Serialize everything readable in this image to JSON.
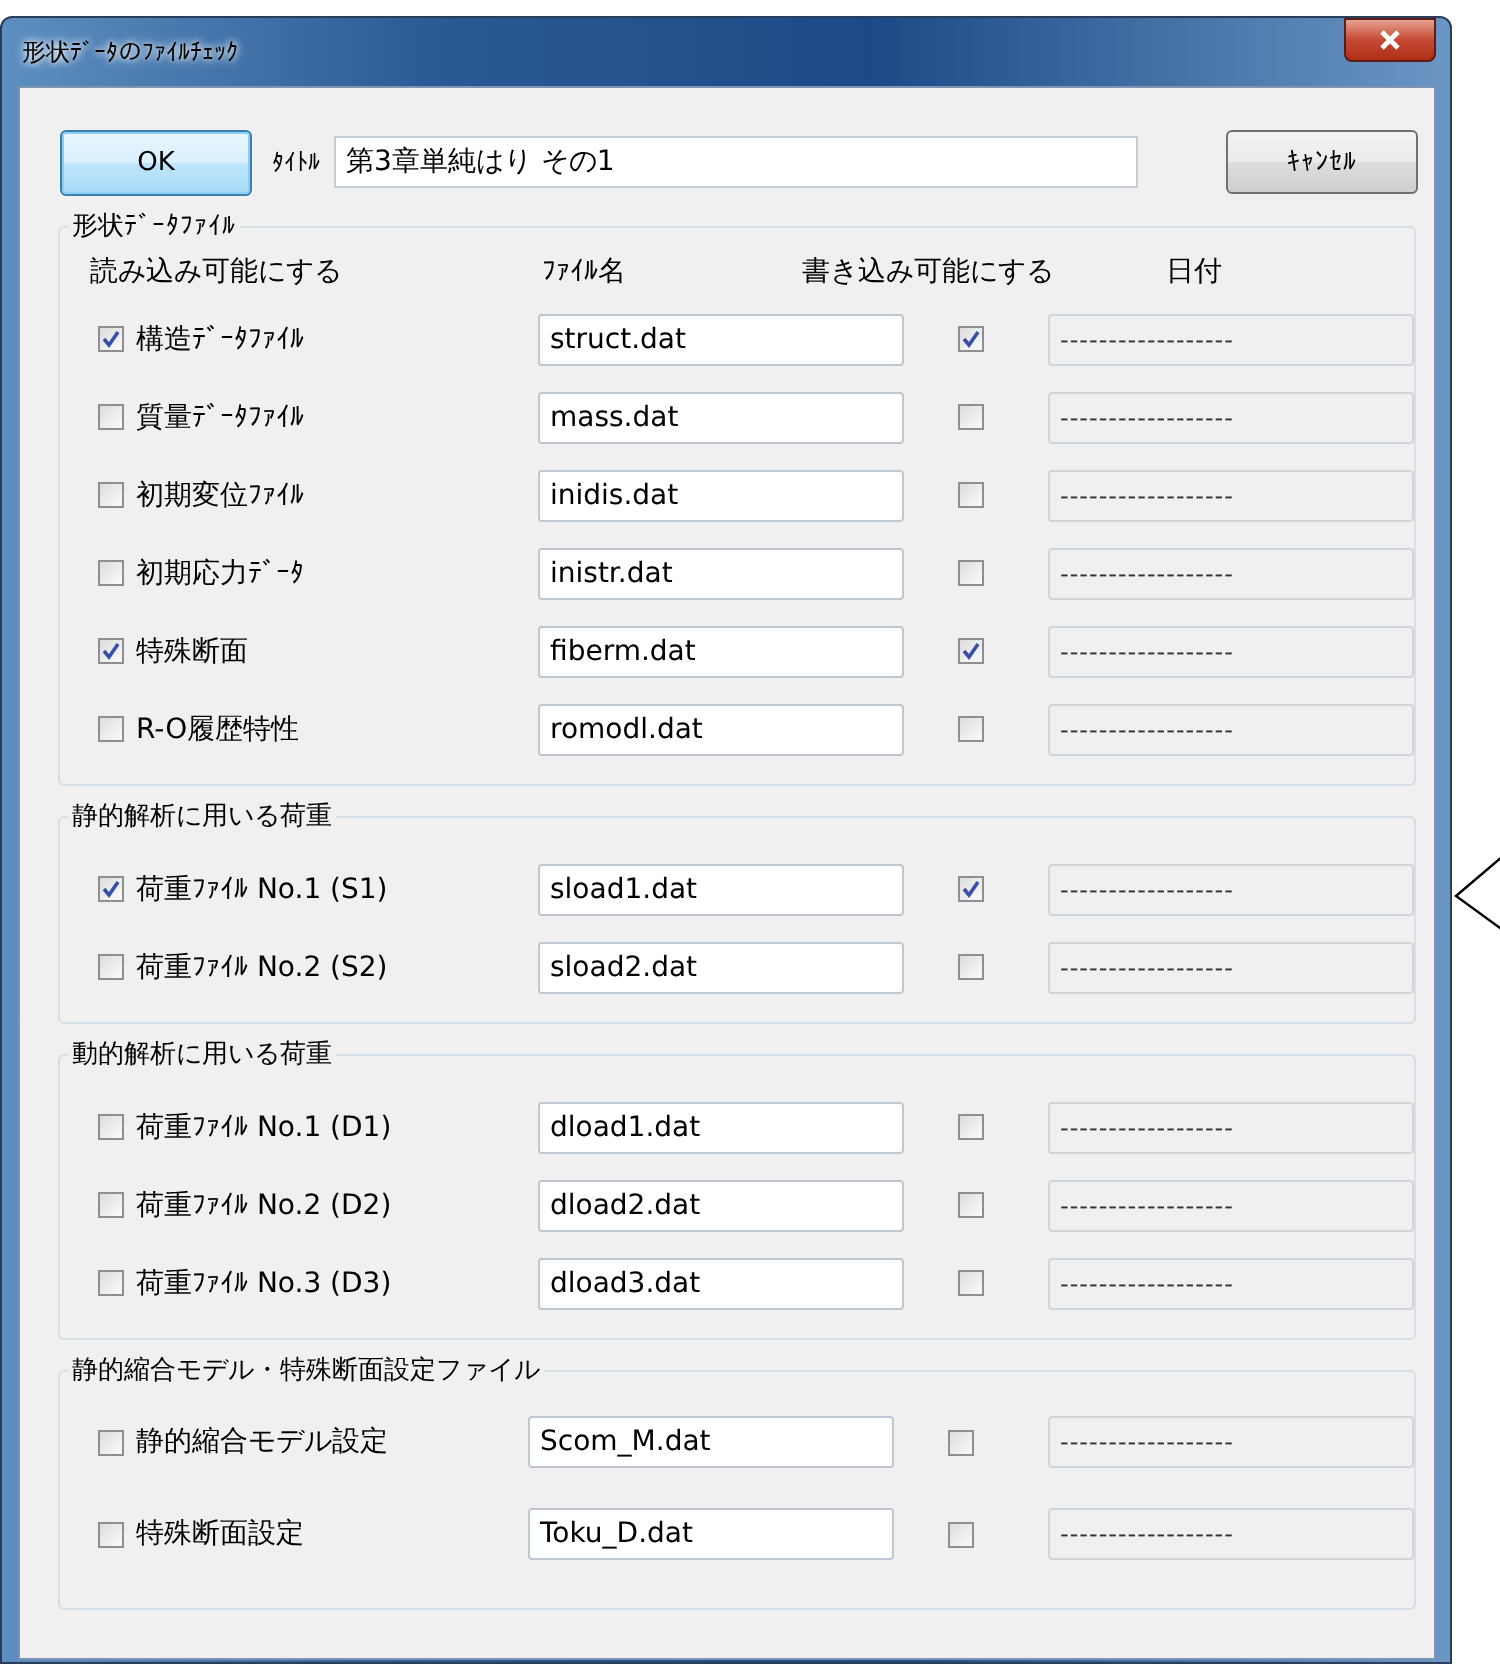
{
  "window": {
    "title": "形状ﾃﾞｰﾀのﾌｧｲﾙﾁｪｯｸ"
  },
  "toolbar": {
    "ok": "OK",
    "title_label": "ﾀｲﾄﾙ",
    "title_value": "第3章単純はり  その1",
    "cancel": "ｷｬﾝｾﾙ"
  },
  "groups": [
    {
      "title": "形状ﾃﾞｰﾀﾌｧｲﾙ",
      "columns": [
        "読み込み可能にする",
        "ﾌｧｲﾙ名",
        "書き込み可能にする",
        "日付"
      ],
      "rows": [
        {
          "label": "構造ﾃﾞｰﾀﾌｧｲﾙ",
          "checked": true,
          "file": "struct.dat",
          "write_checked": true,
          "date": "------------------"
        },
        {
          "label": "質量ﾃﾞｰﾀﾌｧｲﾙ",
          "checked": false,
          "file": "mass.dat",
          "write_checked": false,
          "date": "------------------"
        },
        {
          "label": "初期変位ﾌｧｲﾙ",
          "checked": false,
          "file": "inidis.dat",
          "write_checked": false,
          "date": "------------------"
        },
        {
          "label": "初期応力ﾃﾞｰﾀ",
          "checked": false,
          "file": "inistr.dat",
          "write_checked": false,
          "date": "------------------"
        },
        {
          "label": "特殊断面",
          "checked": true,
          "file": "fiberm.dat",
          "write_checked": true,
          "date": "------------------"
        },
        {
          "label": "R-O履歴特性",
          "checked": false,
          "file": "romodl.dat",
          "write_checked": false,
          "date": "------------------"
        }
      ]
    },
    {
      "title": "静的解析に用いる荷重",
      "rows": [
        {
          "label": "荷重ﾌｧｲﾙ No.1 (S1)",
          "checked": true,
          "file": "sload1.dat",
          "write_checked": true,
          "date": "------------------"
        },
        {
          "label": "荷重ﾌｧｲﾙ No.2 (S2)",
          "checked": false,
          "file": "sload2.dat",
          "write_checked": false,
          "date": "------------------"
        }
      ]
    },
    {
      "title": "動的解析に用いる荷重",
      "rows": [
        {
          "label": "荷重ﾌｧｲﾙ No.1 (D1)",
          "checked": false,
          "file": "dload1.dat",
          "write_checked": false,
          "date": "------------------"
        },
        {
          "label": "荷重ﾌｧｲﾙ No.2 (D2)",
          "checked": false,
          "file": "dload2.dat",
          "write_checked": false,
          "date": "------------------"
        },
        {
          "label": "荷重ﾌｧｲﾙ No.3 (D3)",
          "checked": false,
          "file": "dload3.dat",
          "write_checked": false,
          "date": "------------------"
        }
      ]
    },
    {
      "title": "静的縮合モデル・特殊断面設定ファイル",
      "rows": [
        {
          "label": "静的縮合モデル設定",
          "checked": false,
          "file": "Scom_M.dat",
          "write_checked": false,
          "date": "------------------"
        },
        {
          "label": "特殊断面設定",
          "checked": false,
          "file": "Toku_D.dat",
          "write_checked": false,
          "date": "------------------"
        }
      ]
    }
  ]
}
